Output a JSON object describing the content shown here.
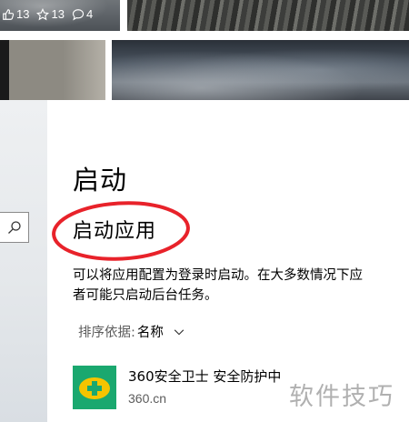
{
  "photo_strip": {
    "stats": [
      {
        "icon": "thumbs-up-icon",
        "value": "13"
      },
      {
        "icon": "star-icon",
        "value": "13"
      },
      {
        "icon": "comment-icon",
        "value": "4"
      }
    ]
  },
  "settings": {
    "page_title": "启动",
    "section_title": "启动应用",
    "description_line1": "可以将应用配置为登录时启动。在大多数情况下应",
    "description_line2": "者可能只启动后台任务。",
    "sort_label": "排序依据:",
    "sort_value": "名称",
    "apps": [
      {
        "name": "360安全卫士 安全防护中",
        "publisher": "360.cn",
        "icon": "360-shield-icon"
      }
    ]
  },
  "annotation": {
    "color": "#e8222a",
    "shape": "ellipse"
  },
  "watermark": "软件技巧",
  "colors": {
    "app_icon_bg": "#1aa86f",
    "app_icon_plus": "#f5c400",
    "secondary_text": "#5c5c5c"
  }
}
